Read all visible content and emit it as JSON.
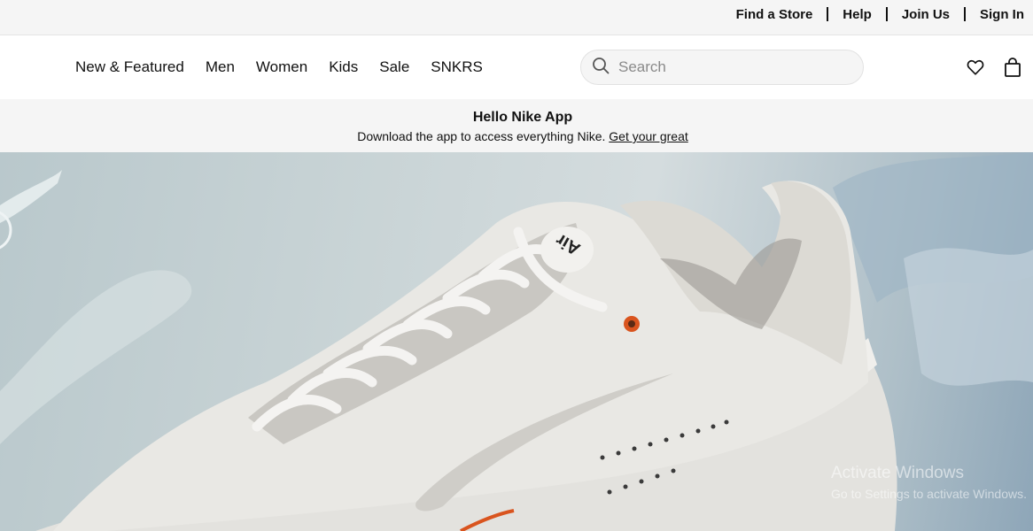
{
  "utility_bar": {
    "links": [
      "Find a Store",
      "Help",
      "Join Us",
      "Sign In"
    ]
  },
  "nav": {
    "items": [
      "New & Featured",
      "Men",
      "Women",
      "Kids",
      "Sale",
      "SNKRS"
    ]
  },
  "search": {
    "placeholder": "Search"
  },
  "header_icons": [
    "heart-icon",
    "bag-icon"
  ],
  "promo": {
    "title": "Hello Nike App",
    "text": "Download the app to access everything Nike.",
    "link": "Get your great"
  },
  "hero": {
    "logo_text": "Air"
  },
  "watermark": {
    "title": "Activate Windows",
    "subtitle": "Go to Settings to activate Windows."
  },
  "colors": {
    "background": "#ffffff",
    "bar": "#f5f5f5",
    "text": "#111111",
    "accent_orange": "#d9541e"
  }
}
